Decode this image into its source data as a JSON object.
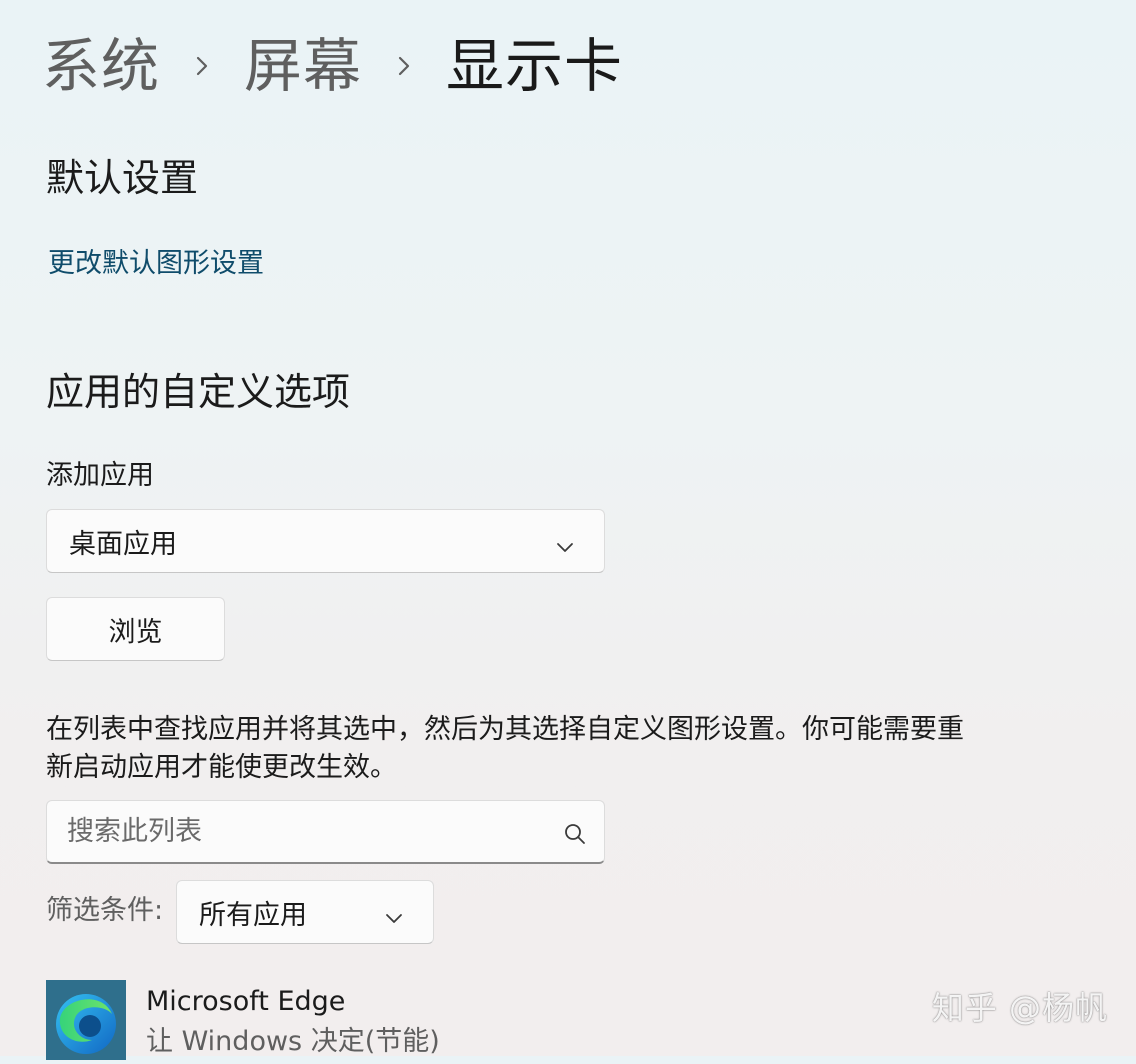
{
  "breadcrumb": {
    "items": [
      "系统",
      "屏幕",
      "显示卡"
    ]
  },
  "default_settings": {
    "title": "默认设置",
    "link_label": "更改默认图形设置"
  },
  "custom_options": {
    "title": "应用的自定义选项",
    "add_app_label": "添加应用",
    "app_type_selected": "桌面应用",
    "browse_label": "浏览",
    "description": "在列表中查找应用并将其选中，然后为其选择自定义图形设置。你可能需要重新启动应用才能使更改生效。",
    "search_placeholder": "搜索此列表",
    "filter_label": "筛选条件:",
    "filter_selected": "所有应用"
  },
  "app_list": [
    {
      "name": "Microsoft Edge",
      "setting": "让 Windows 决定(节能)",
      "icon": "edge-icon"
    }
  ],
  "watermark": "知乎 @杨帆",
  "colors": {
    "link": "#0f4c6b",
    "icon_tile": "#2f6f8c"
  }
}
